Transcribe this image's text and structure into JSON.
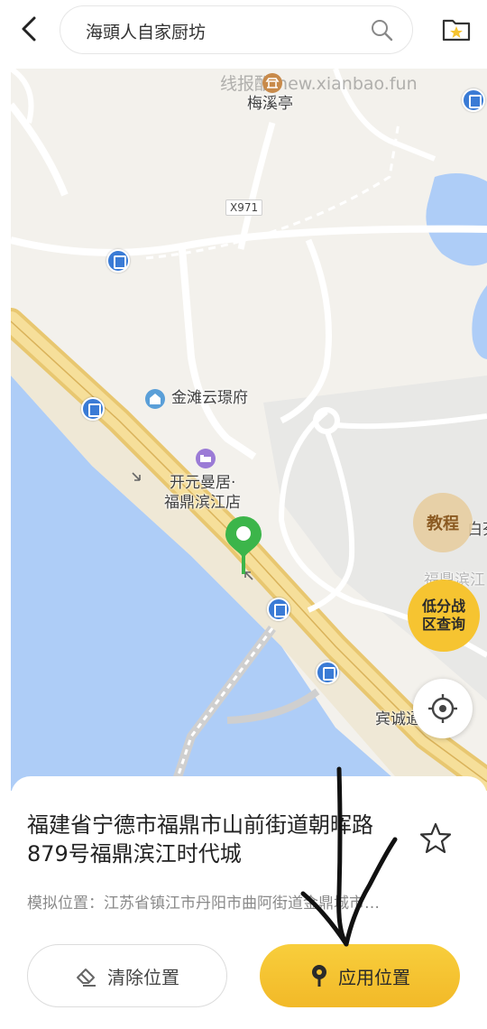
{
  "header": {
    "search_text": "海頭人自家厨坊"
  },
  "map": {
    "watermark": "线报酷 new.xianbao.fun",
    "road_chip": "X971",
    "pois": {
      "meixi": "梅溪亭",
      "jintan": "金滩云璟府",
      "hotel_line1": "开元曼居·",
      "hotel_line2": "福鼎滨江店",
      "right_label": "福鼎滨江",
      "bincheng": "宾诚通",
      "right_top": "白芬"
    },
    "tutorial_label": "教程",
    "lowscore_line1": "低分战",
    "lowscore_line2": "区查询"
  },
  "sheet": {
    "address": "福建省宁德市福鼎市山前街道朝晖路879号福鼎滨江时代城",
    "simulated": "模拟位置：江苏省镇江市丹阳市曲阿街道金鼎城市…",
    "clear_label": "清除位置",
    "apply_label": "应用位置"
  },
  "colors": {
    "accent": "#f6c431",
    "pin": "#3cb54a",
    "water": "#aecdf7",
    "road": "#f1d07a"
  }
}
